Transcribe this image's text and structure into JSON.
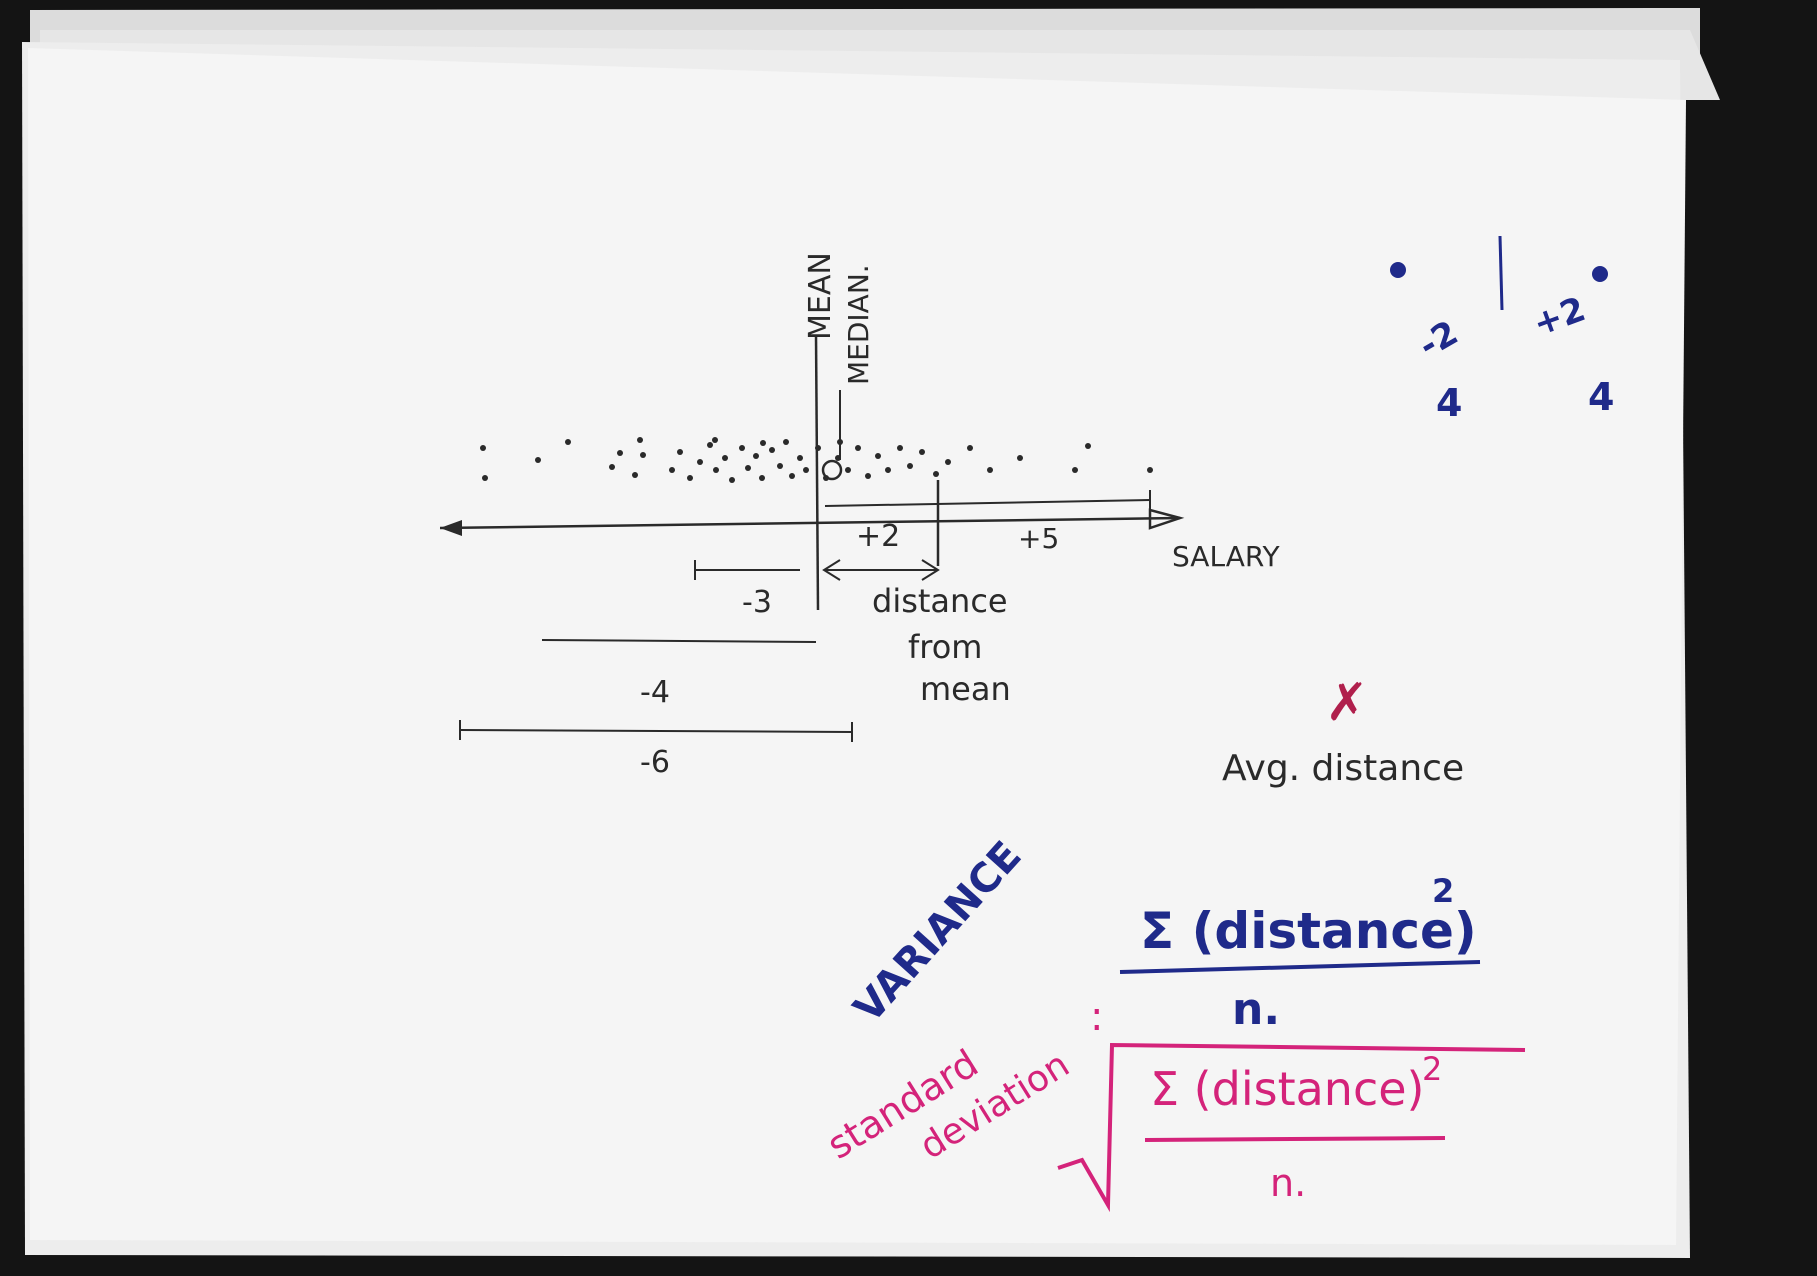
{
  "labels": {
    "mean": "MEAN",
    "median": "MEDIAN.",
    "salary": "SALARY",
    "plus2": "+2",
    "plus5": "+5",
    "minus3": "-3",
    "minus4": "-4",
    "minus6": "-6",
    "distance_line1": "distance",
    "distance_line2": "from",
    "distance_line3": "mean",
    "avg_distance": "Avg. distance",
    "cross": "✗",
    "corner_minus2": "-2",
    "corner_plus2": "+2",
    "corner_4a": "4",
    "corner_4b": "4",
    "variance": "VARIANCE",
    "formula_sigma": "Σ (distance)",
    "formula_exp": "2",
    "formula_n": "n.",
    "std_line1": "standard",
    "std_line2": "deviation",
    "std_colon": ":",
    "sqrt_sigma": "Σ (distance)",
    "sqrt_exp": "2",
    "sqrt_n": "n."
  },
  "colors": {
    "ink_black": "#2a2a2a",
    "ink_blue": "#1f2a8a",
    "ink_pink": "#d4237a",
    "paper": "#f4f4f4",
    "background": "#141414"
  }
}
